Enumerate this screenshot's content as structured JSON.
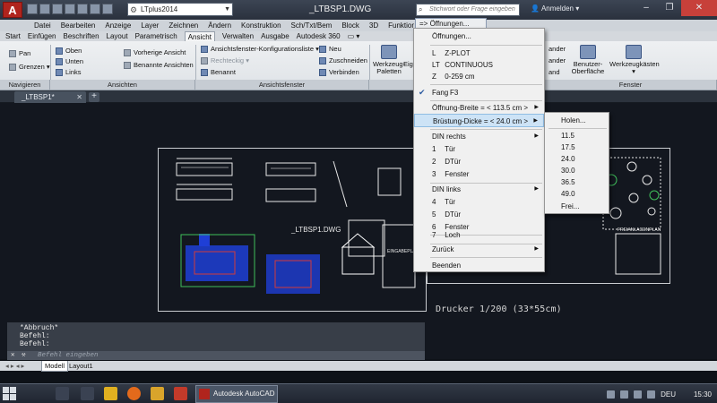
{
  "app": {
    "logo_letter": "A",
    "workspace": "LTplus2014",
    "doc_title": "_LTBSP1.DWG",
    "search_placeholder": "Stichwort oder Frage eingeben",
    "login_label": "Anmelden",
    "accent_color": "#b0241d"
  },
  "menubar": [
    "Datei",
    "Bearbeiten",
    "Anzeige",
    "Layer",
    "Zeichnen",
    "Ändern",
    "Konstruktion",
    "Sch/Txt/Bem",
    "Block",
    "3D",
    "Funktion"
  ],
  "ribbon_tabs": [
    "Start",
    "Einfügen",
    "Beschriften",
    "Layout",
    "Parametrisch",
    "Ansicht",
    "Verwalten",
    "Ausgabe",
    "Autodesk 360"
  ],
  "ribbon_active_tab": "Ansicht",
  "ribbon_more": "▭ ▾",
  "ribbon": {
    "nav": {
      "pan": "Pan",
      "grenzen": "Grenzen",
      "title": "Navigieren"
    },
    "views": {
      "oben": "Oben",
      "unten": "Unten",
      "links": "Links",
      "vorherige": "Vorherige Ansicht",
      "benannte": "Benannte Ansichten",
      "title": "Ansichten"
    },
    "vp": {
      "konfig": "Ansichtsfenster-Konfigurationsliste",
      "rechteck": "Rechteckig",
      "benannt": "Benannt",
      "neu": "Neu",
      "zuschneiden": "Zuschneiden",
      "verbinden": "Verbinden",
      "title": "Ansichtsfenster"
    },
    "palettes": {
      "werkzeug": "Werkzeug-",
      "paletten": "Paletten",
      "eig": "Eig"
    },
    "fenster": {
      "ander1": "ander",
      "ander2": "ander",
      "and3": "and",
      "benutzer": "Benutzer-",
      "oberflaeche": "Oberfläche",
      "werkzeugkaesten": "Werkzeugkästen",
      "title": "Fenster"
    }
  },
  "doc_tab": "_LTBSP1*",
  "command": {
    "history": [
      "*Abbruch*",
      "Befehl:",
      "Befehl:"
    ],
    "prompt": "Befehl eingeben"
  },
  "layout_tabs": [
    "Modell",
    "Layout1"
  ],
  "printer_label": "Drucker 1/200 (33*55cm)",
  "drawing_text": {
    "title1": "_LTBSP1.DWG",
    "eingabe": "EINGABEPLAN",
    "frei": "FREIANLAGENPLAN"
  },
  "open_cmd": "=> Öffnungen...",
  "context_menu": {
    "items": [
      {
        "code": "",
        "label": "Öffnungen..."
      },
      {
        "code": "L",
        "label": "Z-PLOT"
      },
      {
        "code": "LT",
        "label": "CONTINUOUS"
      },
      {
        "code": "Z",
        "label": "0-259 cm"
      },
      {
        "code": "",
        "label": "Fang",
        "shortcut": "F3",
        "checked": true
      },
      {
        "code": "",
        "label": "Öffnung-Breite = < 113.5 cm >",
        "submenu": true
      },
      {
        "code": "",
        "label": "Brüstung-Dicke = < 24.0 cm >",
        "submenu": true,
        "selected": true
      },
      {
        "code": "",
        "label": "DIN rechts",
        "submenu": true
      },
      {
        "code": "1",
        "label": "Tür"
      },
      {
        "code": "2",
        "label": "DTür"
      },
      {
        "code": "3",
        "label": "Fenster"
      },
      {
        "code": "",
        "label": "DIN links",
        "submenu": true
      },
      {
        "code": "4",
        "label": "Tür"
      },
      {
        "code": "5",
        "label": "DTür"
      },
      {
        "code": "6",
        "label": "Fenster"
      },
      {
        "code": "7",
        "label": "Loch"
      },
      {
        "code": "",
        "label": "Zurück",
        "submenu": true
      },
      {
        "code": "",
        "label": "Beenden"
      }
    ],
    "submenu": [
      "Holen...",
      "11.5",
      "17.5",
      "24.0",
      "30.0",
      "36.5",
      "49.0",
      "Frei..."
    ]
  },
  "taskbar": {
    "task": "Autodesk AutoCAD ...",
    "lang": "DEU",
    "time": "15:30"
  }
}
